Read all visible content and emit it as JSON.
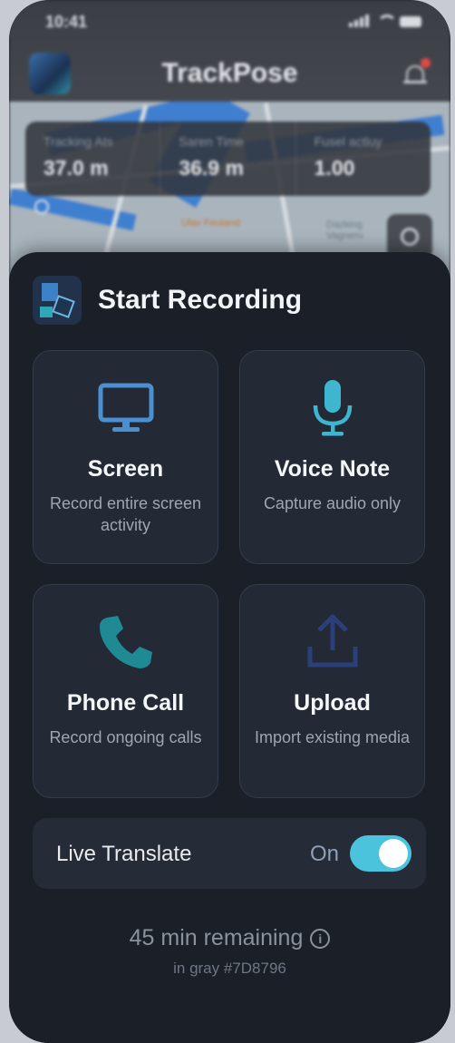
{
  "status_bar": {
    "time": "10:41"
  },
  "header": {
    "app_title": "TrackPose"
  },
  "stats": [
    {
      "label": "Tracking Ats",
      "value": "37.0 m"
    },
    {
      "label": "Saren Time",
      "value": "36.9 m"
    },
    {
      "label": "Fusel actluy",
      "value": "1.00"
    }
  ],
  "map": {
    "labels": [
      "Ulav Feuland",
      "Dazking Vagneru"
    ]
  },
  "sheet": {
    "title": "Start Recording",
    "options": [
      {
        "label": "Screen",
        "description": "Record entire screen activity",
        "icon": "monitor-icon",
        "color": "#4a8fd0"
      },
      {
        "label": "Voice Note",
        "description": "Capture audio only",
        "icon": "microphone-icon",
        "color": "#3fb6cf"
      },
      {
        "label": "Phone Call",
        "description": "Record ongoing calls",
        "icon": "phone-icon",
        "color": "#1f8a94"
      },
      {
        "label": "Upload",
        "description": "Import existing media",
        "icon": "upload-icon",
        "color": "#2b3f78"
      }
    ],
    "toggle": {
      "label": "Live Translate",
      "state": "On",
      "enabled": true,
      "accent": "#4cc3dc"
    },
    "remaining": "45 min remaining",
    "remaining_note": "in gray #7D8796"
  }
}
